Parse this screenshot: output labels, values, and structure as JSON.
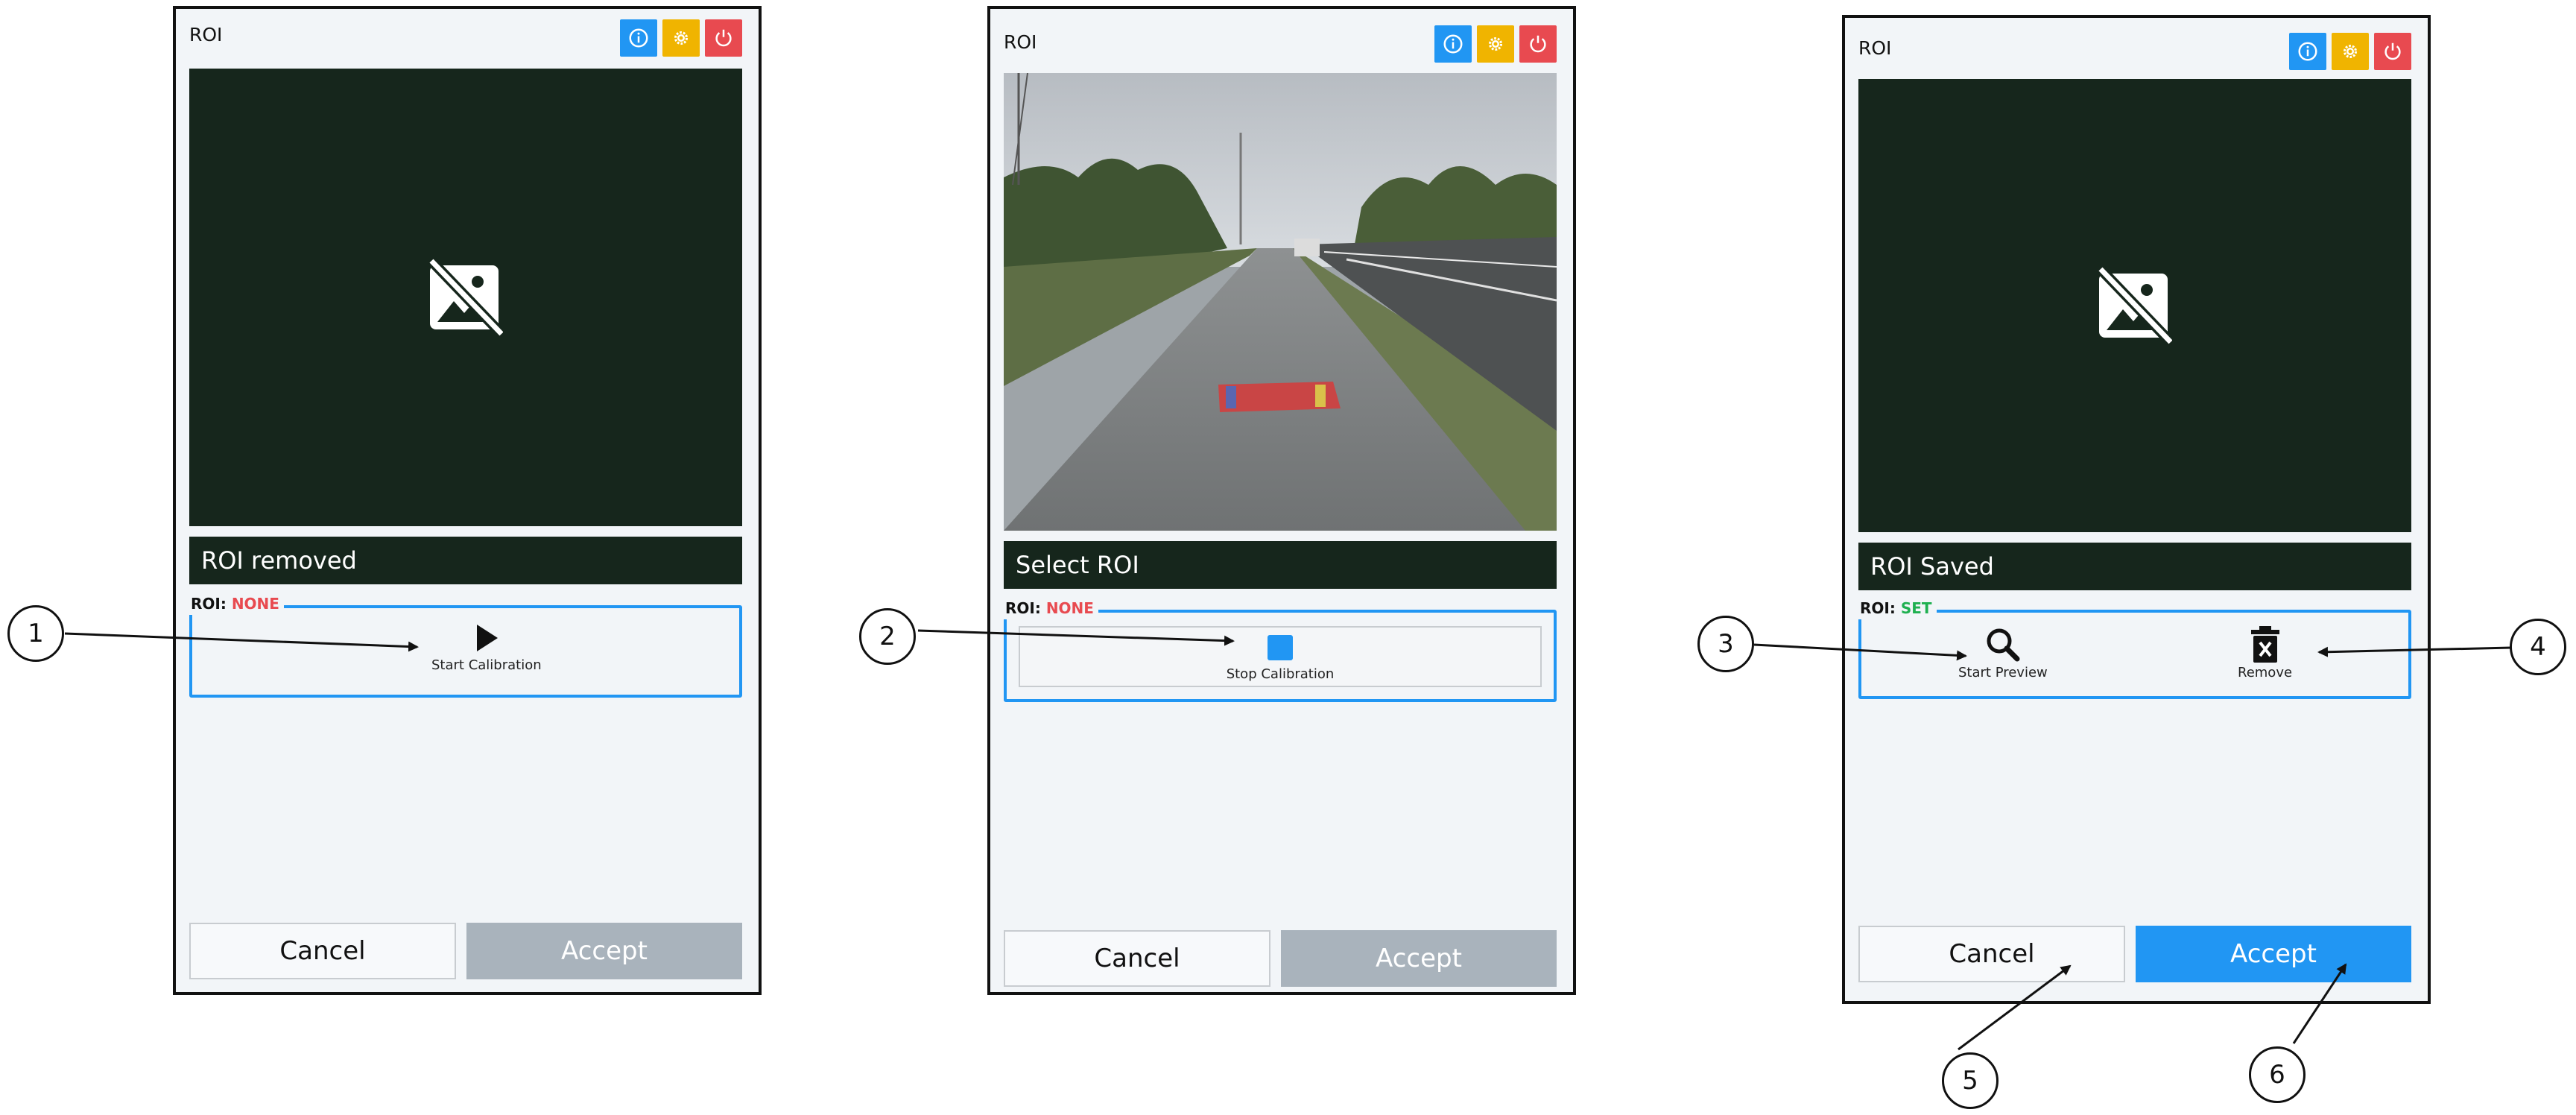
{
  "header_icons": {
    "info": {
      "icon": "info-icon",
      "color": "#2196f3"
    },
    "settings": {
      "icon": "gear-icon",
      "color": "#f0b400"
    },
    "power": {
      "icon": "power-icon",
      "color": "#e84a50"
    }
  },
  "panels": [
    {
      "title": "ROI",
      "status": "ROI removed",
      "roi_label": "ROI:",
      "roi_value": "NONE",
      "action": {
        "icon": "play-icon",
        "label": "Start Calibration"
      },
      "cancel": "Cancel",
      "accept": "Accept",
      "accept_enabled": false
    },
    {
      "title": "ROI",
      "status": "Select ROI",
      "roi_label": "ROI:",
      "roi_value": "NONE",
      "action": {
        "icon": "stop-icon",
        "label": "Stop Calibration"
      },
      "cancel": "Cancel",
      "accept": "Accept",
      "accept_enabled": false
    },
    {
      "title": "ROI",
      "status": "ROI Saved",
      "roi_label": "ROI:",
      "roi_value": "SET",
      "actions": [
        {
          "icon": "search-icon",
          "label": "Start Preview"
        },
        {
          "icon": "trash-icon",
          "label": "Remove"
        }
      ],
      "cancel": "Cancel",
      "accept": "Accept",
      "accept_enabled": true
    }
  ],
  "callouts": [
    "1",
    "2",
    "3",
    "4",
    "5",
    "6"
  ],
  "colors": {
    "accent": "#2196f3",
    "none": "#e84a50",
    "set": "#1fb050",
    "viewer_bg": "#16261c",
    "disabled": "#a9b3bc"
  }
}
